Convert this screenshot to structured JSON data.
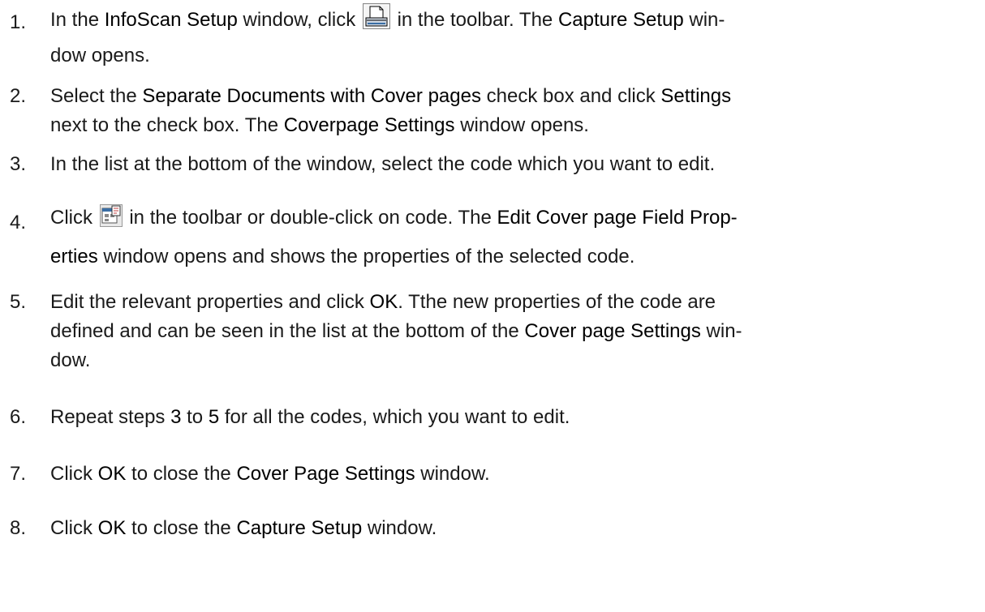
{
  "steps": [
    {
      "num": "1.",
      "p1": "In the ",
      "b1": "InfoScan Setup",
      "p2": " window, click ",
      "icon": "scanner-icon",
      "p3": " in the toolbar. The ",
      "b2": "Capture Setup",
      "p4": " win-",
      "line2": "dow opens."
    },
    {
      "num": "2.",
      "p1": "Select the ",
      "b1": "Separate Documents with Cover pages",
      "p2": " check box and click ",
      "b2": "Settings",
      "p3": "next to the check box. The ",
      "b3": "Coverpage Settings",
      "p4": " window opens."
    },
    {
      "num": "3.",
      "text": "In the list at the bottom of the window, select the code which you want to edit."
    },
    {
      "num": "4.",
      "p1": "Click ",
      "icon": "properties-icon",
      "p2": " in the toolbar or double-click on code. The ",
      "b1": "Edit Cover page Field Prop-",
      "b2": "erties",
      "p3": " window opens and shows the properties of the selected code."
    },
    {
      "num": "5.",
      "p1": "Edit the relevant properties and click ",
      "b1": "OK",
      "p2": ". Tthe new properties of the code are",
      "line2a": "defined and can be seen in the list at the bottom of the ",
      "b2": "Cover page Settings",
      "line2b": " win-",
      "line3": "dow."
    },
    {
      "num": "6.",
      "p1": "Repeat steps ",
      "b1": "3",
      "p2": " to ",
      "b2": "5",
      "p3": " for all the codes, which you want to edit."
    },
    {
      "num": "7.",
      "p1": "Click ",
      "b1": "OK",
      "p2": " to close the ",
      "b2": "Cover Page Settings",
      "p3": " window."
    },
    {
      "num": "8.",
      "p1": "Click ",
      "b1": "OK",
      "p2": " to close the ",
      "b2": "Capture Setup",
      "p3": " window."
    }
  ]
}
